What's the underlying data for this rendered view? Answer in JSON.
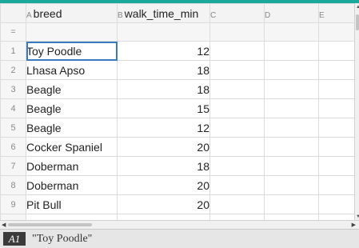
{
  "colors": {
    "accent_bar": "#1aa89a",
    "selection": "#3a7bbf"
  },
  "sheet": {
    "columns": [
      {
        "letter": "A",
        "name": "breed"
      },
      {
        "letter": "B",
        "name": "walk_time_min"
      },
      {
        "letter": "C",
        "name": ""
      },
      {
        "letter": "D",
        "name": ""
      },
      {
        "letter": "E",
        "name": ""
      }
    ],
    "formula_row_label": "=",
    "rows": [
      {
        "num": "1",
        "breed": "Toy Poodle",
        "walk": "12"
      },
      {
        "num": "2",
        "breed": "Lhasa Apso",
        "walk": "18"
      },
      {
        "num": "3",
        "breed": "Beagle",
        "walk": "18"
      },
      {
        "num": "4",
        "breed": "Beagle",
        "walk": "15"
      },
      {
        "num": "5",
        "breed": "Beagle",
        "walk": "12"
      },
      {
        "num": "6",
        "breed": "Cocker Spaniel",
        "walk": "20"
      },
      {
        "num": "7",
        "breed": "Doberman",
        "walk": "18"
      },
      {
        "num": "8",
        "breed": "Doberman",
        "walk": "20"
      },
      {
        "num": "9",
        "breed": "Pit Bull",
        "walk": "20"
      }
    ]
  },
  "entry_line": {
    "cell_ref": "A1",
    "content": "\"Toy Poodle\""
  }
}
